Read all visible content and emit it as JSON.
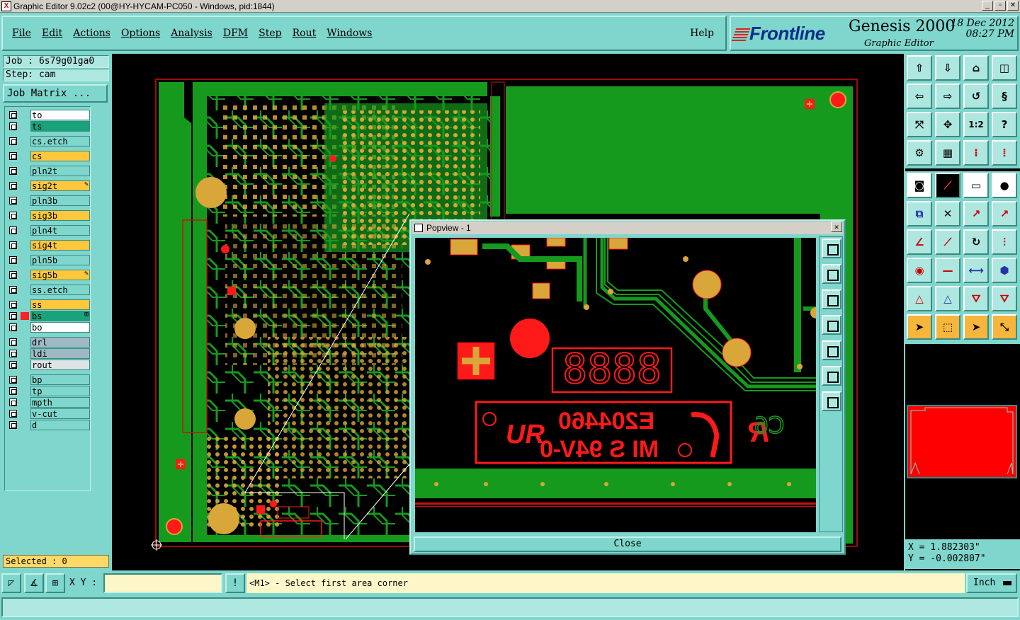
{
  "window": {
    "title": "Graphic Editor 9.02c2 (00@HY-HYCAM-PC050 - Windows, pid:1844)"
  },
  "menu": {
    "items": [
      {
        "label": "File"
      },
      {
        "label": "Edit"
      },
      {
        "label": "Actions"
      },
      {
        "label": "Options"
      },
      {
        "label": "Analysis"
      },
      {
        "label": "DFM"
      },
      {
        "label": "Step"
      },
      {
        "label": "Rout"
      },
      {
        "label": "Windows"
      }
    ],
    "help": "Help"
  },
  "brand": {
    "logo": "Frontline",
    "product": "Genesis 2000",
    "subtitle": "Graphic Editor",
    "date": "18 Dec 2012",
    "time": "08:27 PM"
  },
  "job": {
    "job_label": "Job : 6s79g01ga0",
    "step_label": "Step: cam",
    "matrix_button": "Job Matrix ..."
  },
  "layers": [
    {
      "name": "to",
      "color": "#ffffff",
      "mark": ""
    },
    {
      "name": "ts",
      "color": "#1aa37a",
      "mark": ""
    },
    {
      "name": "cs.etch",
      "color": "#7fd6cc",
      "mark": ""
    },
    {
      "name": "cs",
      "color": "#ffc83c",
      "mark": ""
    },
    {
      "name": "pln2t",
      "color": "#7fd6cc",
      "mark": ""
    },
    {
      "name": "sig2t",
      "color": "#ffc83c",
      "mark": "✎"
    },
    {
      "name": "pln3b",
      "color": "#7fd6cc",
      "mark": ""
    },
    {
      "name": "sig3b",
      "color": "#ffc83c",
      "mark": ""
    },
    {
      "name": "pln4t",
      "color": "#7fd6cc",
      "mark": ""
    },
    {
      "name": "sig4t",
      "color": "#ffc83c",
      "mark": ""
    },
    {
      "name": "pln5b",
      "color": "#7fd6cc",
      "mark": ""
    },
    {
      "name": "sig5b",
      "color": "#ffc83c",
      "mark": "✎"
    },
    {
      "name": "ss.etch",
      "color": "#7fd6cc",
      "mark": ""
    },
    {
      "name": "ss",
      "color": "#ffc83c",
      "mark": ""
    },
    {
      "name": "bs",
      "color": "#1aa37a",
      "mark": "⊞"
    },
    {
      "name": "bo",
      "color": "#ffffff",
      "mark": ""
    },
    {
      "name": "drl",
      "color": "#9fb8c4",
      "mark": ""
    },
    {
      "name": "ldi",
      "color": "#9fb8c4",
      "mark": ""
    },
    {
      "name": "rout",
      "color": "#dde4e4",
      "mark": ""
    },
    {
      "name": "bp",
      "color": "#7fd6cc",
      "mark": ""
    },
    {
      "name": "tp",
      "color": "#7fd6cc",
      "mark": ""
    },
    {
      "name": "mpth",
      "color": "#7fd6cc",
      "mark": ""
    },
    {
      "name": "v-cut",
      "color": "#7fd6cc",
      "mark": ""
    },
    {
      "name": "d",
      "color": "#7fd6cc",
      "mark": ""
    }
  ],
  "selected": "Selected : 0",
  "popview": {
    "title": "Popview - 1",
    "close_label": "Close",
    "marking_line1": "E204460",
    "marking_line2": "MI S 94V-0",
    "silk": "C6",
    "digits": "8888"
  },
  "coords": {
    "x": "X = 1.882303\"",
    "y": "Y = -0.002807\""
  },
  "bottom": {
    "xy_label": "X Y :",
    "xy_value": "",
    "excl": "!",
    "prompt": "<M1> - Select first area corner",
    "units": "Inch"
  },
  "colors": {
    "board_green": "#169a1e",
    "pad_orange": "#d9a63a",
    "mask_red": "#ff1a1a",
    "panel": "#7fd6cc"
  }
}
